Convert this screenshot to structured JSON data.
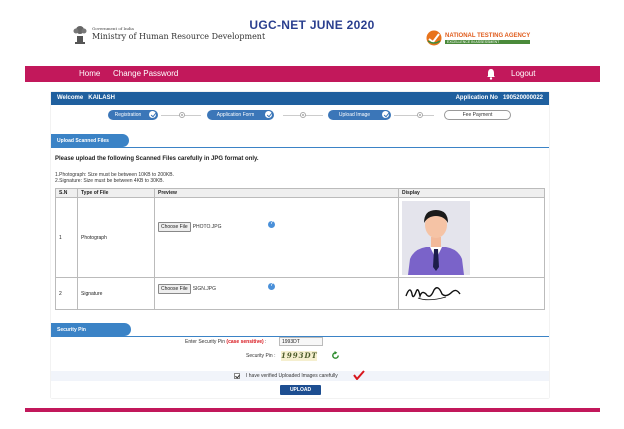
{
  "header": {
    "ministry_small": "Government of India",
    "ministry_name": "Ministry of Human Resource Development",
    "page_title": "UGC-NET JUNE 2020",
    "nta_name": "NATIONAL TESTING AGENCY",
    "nta_tagline": "EXCELLENCE IN ASSESSMENT"
  },
  "nav": {
    "home": "Home",
    "change_password": "Change Password",
    "logout": "Logout"
  },
  "welcome": {
    "label": "Welcome",
    "name": "KAILASH",
    "application_label": "Application No",
    "application_no": "190520000022"
  },
  "steps": [
    {
      "label": "Registration",
      "status": "done"
    },
    {
      "label": "Application Form",
      "status": "done"
    },
    {
      "label": "Upload Image",
      "status": "done"
    },
    {
      "label": "Fee Payment",
      "status": "pending"
    }
  ],
  "upload_section": {
    "title": "Upload Scanned Files",
    "instruction": "Please upload the following Scanned Files carefully in JPG format only.",
    "note1": "1.Photograph: Size must be between 10KB to 200KB.",
    "note2": "2.Signature: Size must be between 4KB to 30KB."
  },
  "table": {
    "headers": [
      "S.N",
      "Type of File",
      "Preview",
      "Display"
    ],
    "rows": [
      {
        "sn": "1",
        "type": "Photograph",
        "button": "Choose File",
        "file": "PHOTO.JPG"
      },
      {
        "sn": "2",
        "type": "Signature",
        "button": "Choose File",
        "file": "SIGN.JPG"
      }
    ]
  },
  "security": {
    "title": "Security Pin",
    "enter_label": "Enter Security Pin",
    "case_note": "(case sensitive)",
    "entered_value": "1993DT",
    "pin_label": "Security Pin :",
    "captcha": "1993DT",
    "verify_text": "I have verified Uploaded Images carefully",
    "upload_button": "UPLOAD"
  },
  "colors": {
    "brand_pink": "#c2185b",
    "brand_blue": "#1f5f9e",
    "title_blue": "#2a3f8f"
  }
}
